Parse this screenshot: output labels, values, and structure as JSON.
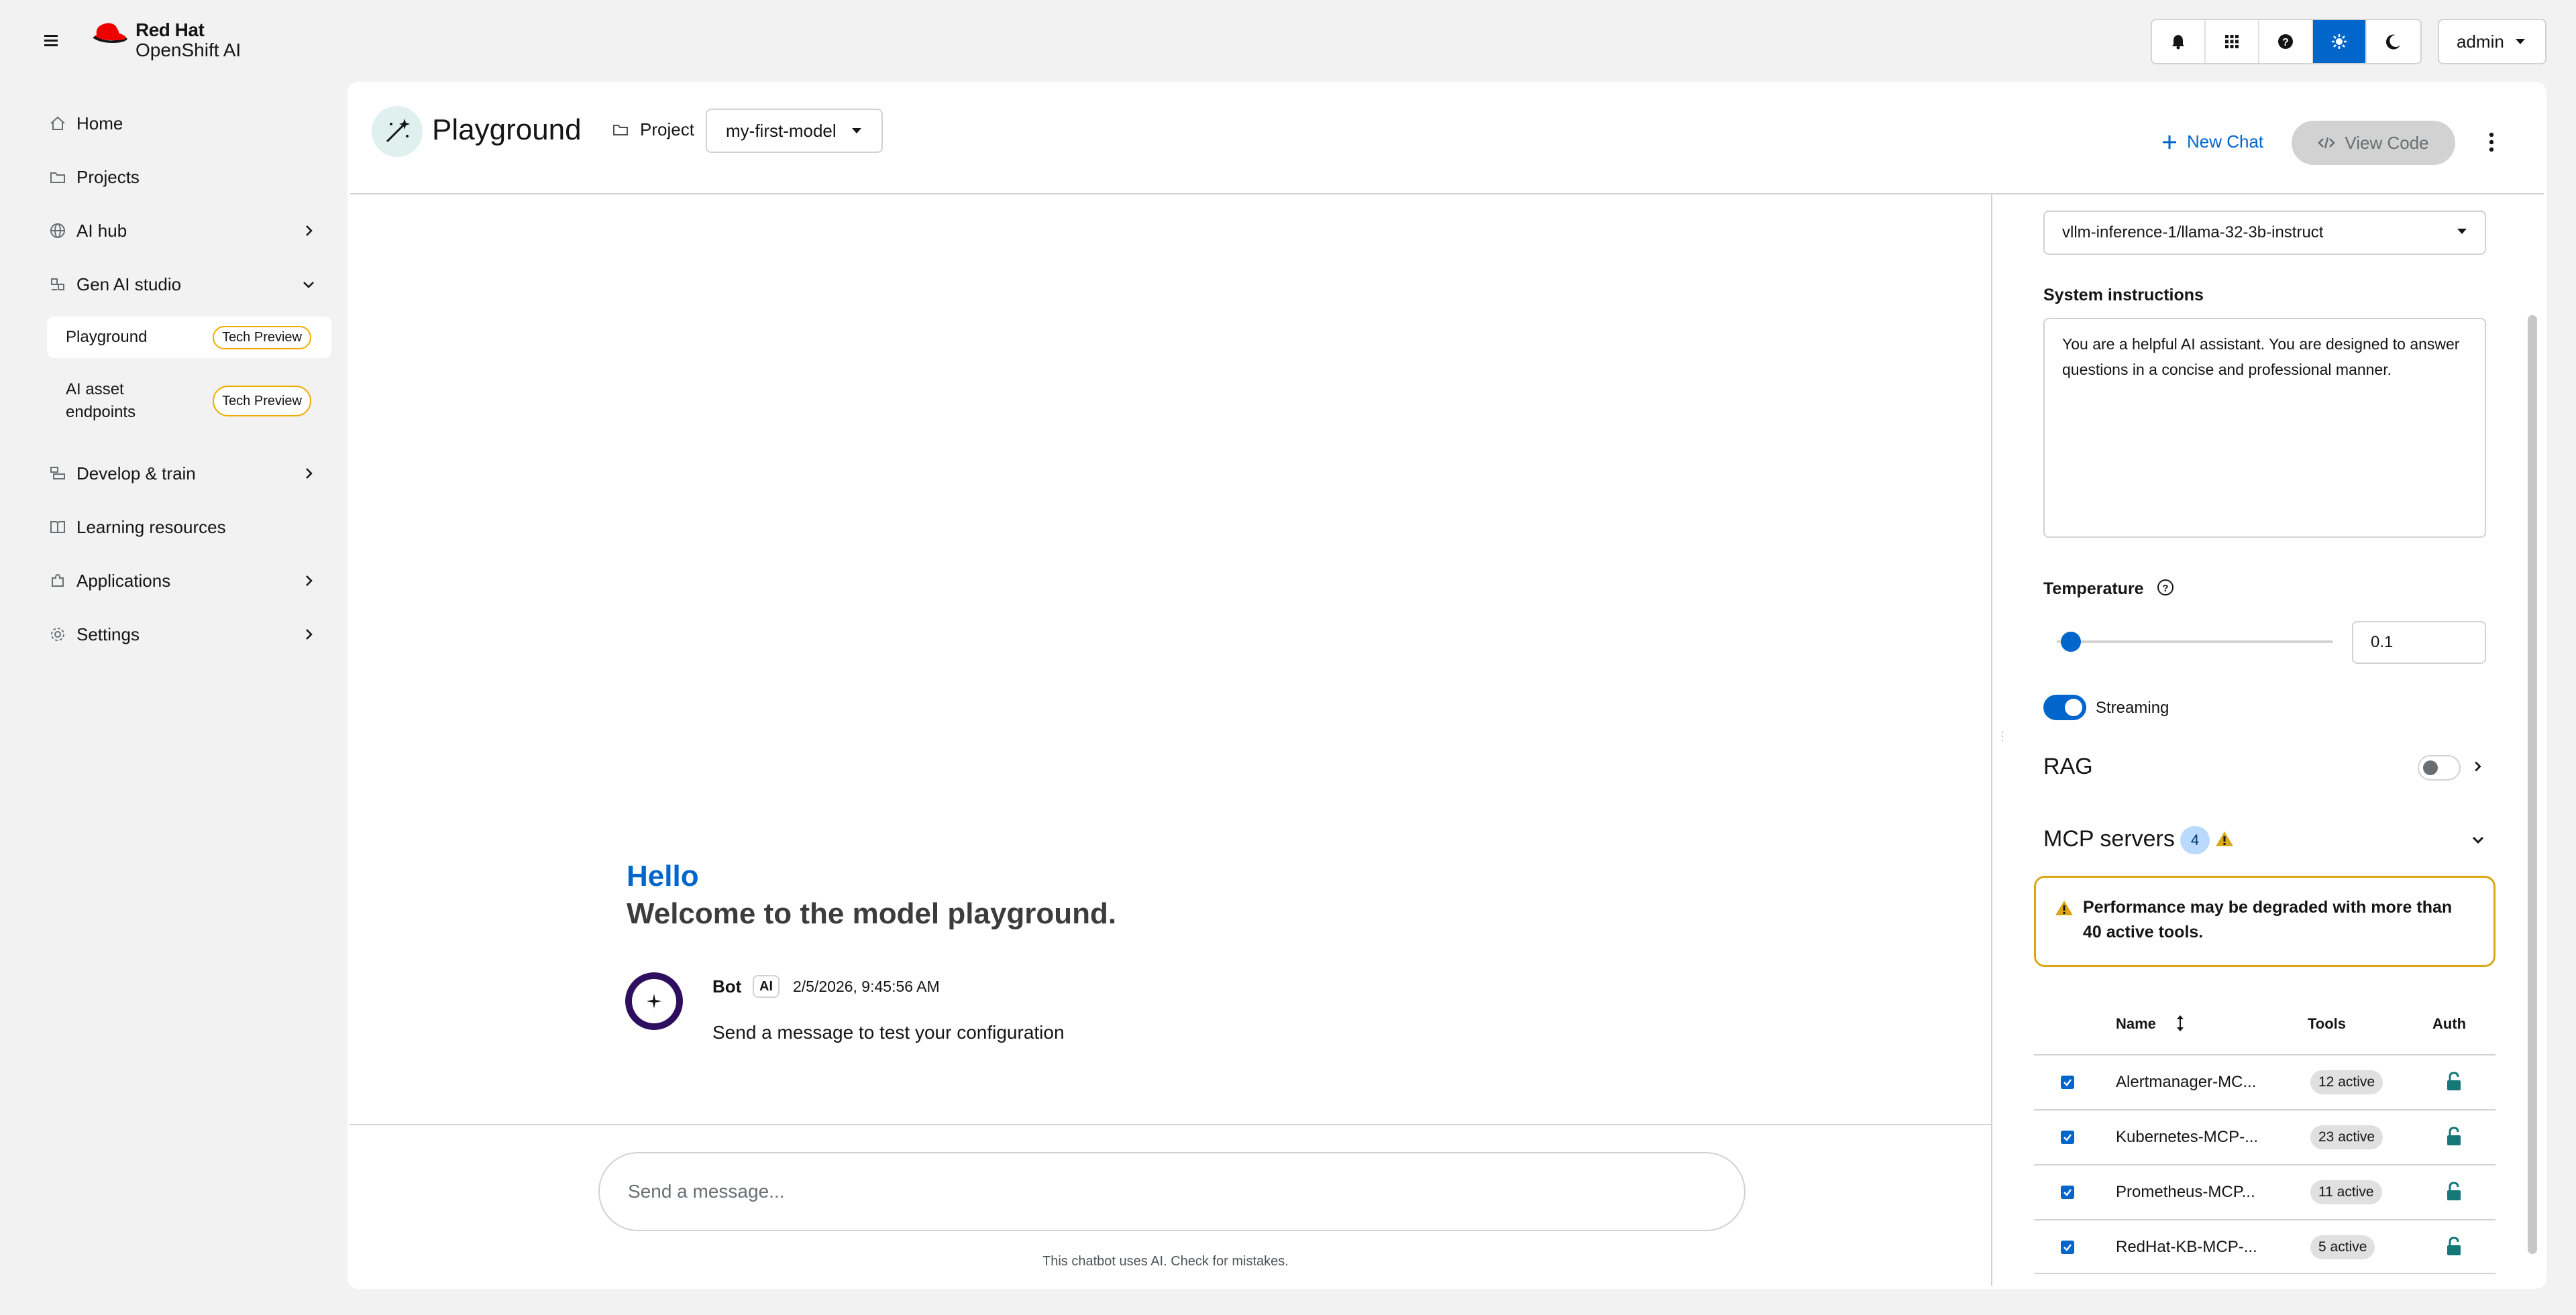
{
  "masthead": {
    "brand_line1": "Red Hat",
    "brand_line2": "OpenShift AI",
    "user": "admin",
    "icons": [
      "notification-bell-icon",
      "app-launcher-icon",
      "help-icon",
      "light-theme-icon",
      "dark-theme-icon"
    ]
  },
  "sidebar": {
    "items": [
      {
        "label": "Home"
      },
      {
        "label": "Projects"
      },
      {
        "label": "AI hub"
      },
      {
        "label": "Gen AI studio"
      },
      {
        "label": "Develop & train"
      },
      {
        "label": "Learning resources"
      },
      {
        "label": "Applications"
      },
      {
        "label": "Settings"
      }
    ],
    "sub_items": [
      {
        "label": "Playground",
        "badge": "Tech Preview"
      },
      {
        "label_line1": "AI asset",
        "label_line2": "endpoints",
        "badge": "Tech Preview"
      }
    ]
  },
  "header": {
    "title": "Playground",
    "project_label": "Project",
    "project_value": "my-first-model",
    "new_chat": "New Chat",
    "view_code": "View Code"
  },
  "chat": {
    "hello": "Hello",
    "welcome": "Welcome to the model playground.",
    "bot_name": "Bot",
    "bot_badge": "AI",
    "timestamp": "2/5/2026, 9:45:56 AM",
    "bot_message": "Send a message to test your configuration",
    "input_placeholder": "Send a message...",
    "disclaimer": "This chatbot uses AI. Check for mistakes."
  },
  "settings": {
    "model": "vllm-inference-1/llama-32-3b-instruct",
    "system_label": "System instructions",
    "system_text": "You are a helpful AI assistant. You are designed to answer questions in a concise and professional manner.",
    "temperature_label": "Temperature",
    "temperature_value": "0.1",
    "temperature_fraction": 0.05,
    "streaming_label": "Streaming",
    "streaming_on": true,
    "rag_label": "RAG",
    "rag_on": false
  },
  "mcp": {
    "title": "MCP servers",
    "count": "4",
    "alert": "Performance may be degraded with more than 40 active tools.",
    "columns": {
      "name": "Name",
      "tools": "Tools",
      "auth": "Auth"
    },
    "rows": [
      {
        "name": "Alertmanager-MC...",
        "tools": "12 active"
      },
      {
        "name": "Kubernetes-MCP-...",
        "tools": "23 active"
      },
      {
        "name": "Prometheus-MCP...",
        "tools": "11 active"
      },
      {
        "name": "RedHat-KB-MCP-...",
        "tools": "5 active"
      }
    ]
  },
  "colors": {
    "accent": "#0066cc",
    "brand_red": "#ee0000",
    "warning": "#dca614"
  }
}
